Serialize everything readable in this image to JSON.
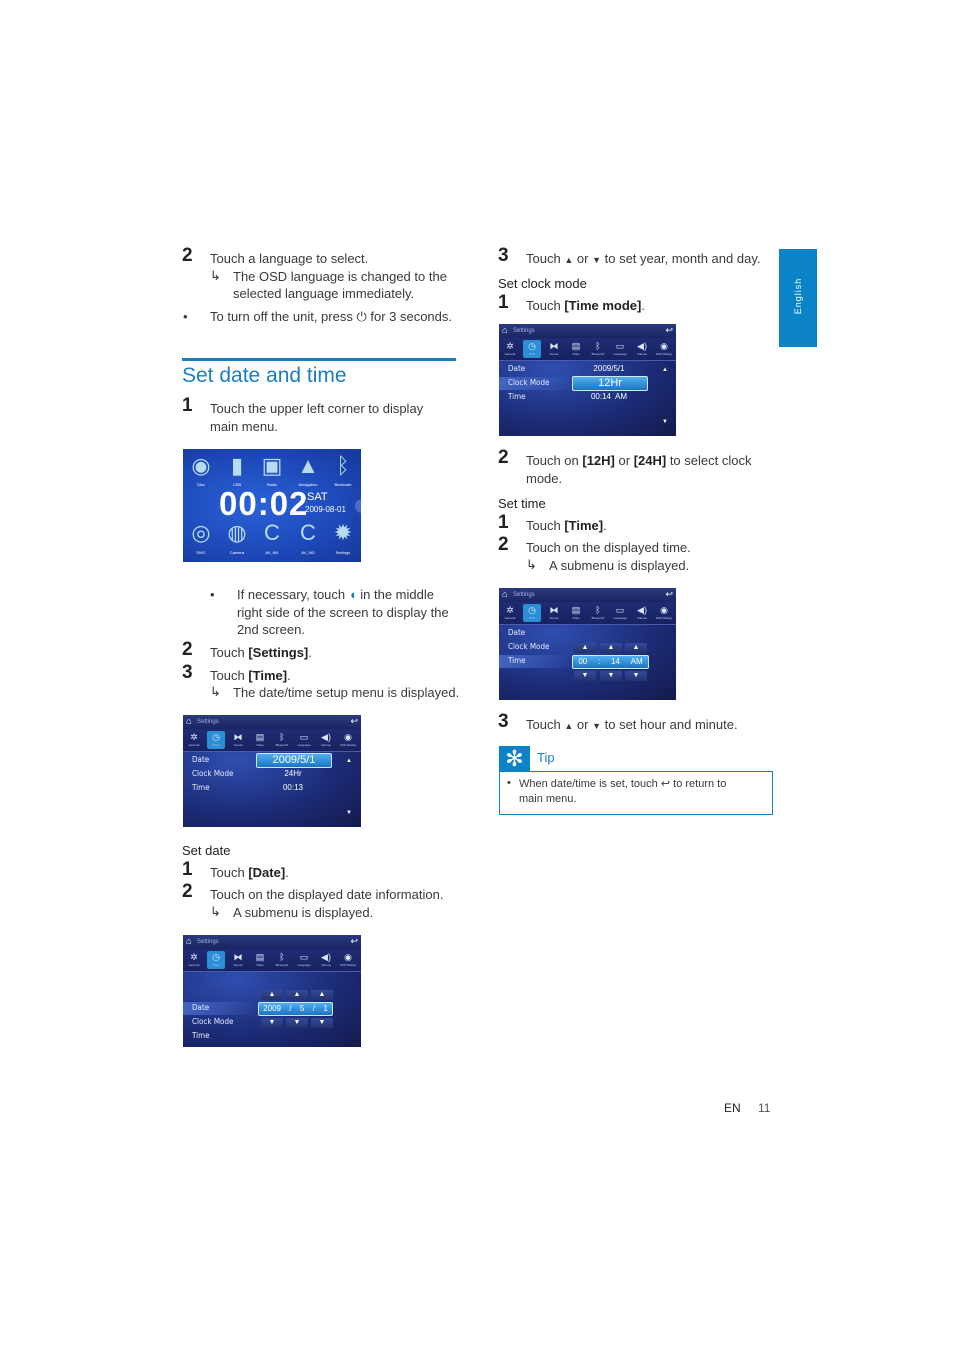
{
  "side_tab": {
    "label": "English"
  },
  "left_column": {
    "step2_lang": {
      "num": "2",
      "text": "Touch a language to select.",
      "result_arrow": "↳",
      "result_line1": "The OSD language is changed to the",
      "result_line2": "selected language immediately."
    },
    "bullet_power": {
      "bullet": "•",
      "text": "To turn off the unit, press ⏻ for 3 seconds."
    },
    "section_title": "Set date and time",
    "step1": {
      "num": "1",
      "line1": "Touch the upper left corner to display",
      "line2": "main menu."
    },
    "main_menu_screen": {
      "top_icons": [
        {
          "icon": "disc-icon",
          "glyph": "◉",
          "label": "Disc"
        },
        {
          "icon": "usb-icon",
          "glyph": "▮",
          "label": "USB"
        },
        {
          "icon": "radio-icon",
          "glyph": "▣",
          "label": "Radio"
        },
        {
          "icon": "navigation-icon",
          "glyph": "▲",
          "label": "Navigation"
        },
        {
          "icon": "bluetooth-icon",
          "glyph": "ᛒ",
          "label": "Bluetooth"
        }
      ],
      "clock": "00:02",
      "day": "SAT",
      "date": "2009-08-01",
      "bottom_icons": [
        {
          "icon": "steering-wheel-icon",
          "glyph": "◎",
          "label": "SWC"
        },
        {
          "icon": "camera-icon",
          "glyph": "◍",
          "label": "Camera"
        },
        {
          "icon": "av-in-icon",
          "glyph": "C",
          "label": "AV_IN1"
        },
        {
          "icon": "av-in-icon",
          "glyph": "C",
          "label": "AV_IN2"
        },
        {
          "icon": "settings-gear-icon",
          "glyph": "✹",
          "label": "Settings"
        }
      ]
    },
    "bullet_second_screen": {
      "bullet": "•",
      "line1a": "If necessary, touch",
      "icon_glyph": "◖",
      "line1b": "in the middle",
      "line2": "right side of the screen to display the",
      "line3": "2nd screen."
    },
    "step2_settings": {
      "num": "2",
      "text_pre": "Touch ",
      "bold": "[Settings]",
      "text_post": "."
    },
    "step3_time": {
      "num": "3",
      "text_pre": "Touch ",
      "bold": "[Time]",
      "text_post": ".",
      "result_arrow": "↳",
      "result": "The date/time setup menu is displayed."
    },
    "set_date_heading": "Set date",
    "set_date_step1": {
      "num": "1",
      "text_pre": "Touch ",
      "bold": "[Date]",
      "text_post": "."
    },
    "set_date_step2": {
      "num": "2",
      "text": "Touch on the displayed date information.",
      "result_arrow": "↳",
      "result": "A submenu is displayed."
    }
  },
  "settings_screen_common": {
    "title": "Settings",
    "home_glyph": "⌂",
    "back_glyph": "↩",
    "tabs": [
      {
        "icon": "gear-icon",
        "glyph": "✲",
        "label": "General"
      },
      {
        "icon": "clock-icon",
        "glyph": "◷",
        "label": "Time"
      },
      {
        "icon": "sound-icon",
        "glyph": "⧓",
        "label": "Sound"
      },
      {
        "icon": "video-icon",
        "glyph": "▤",
        "label": "Video"
      },
      {
        "icon": "bluetooth-icon",
        "glyph": "ᛒ",
        "label": "Bluetooth"
      },
      {
        "icon": "language-icon",
        "glyph": "▭",
        "label": "Language"
      },
      {
        "icon": "volume-icon",
        "glyph": "◀)",
        "label": "Volume"
      },
      {
        "icon": "disc-rating-icon",
        "glyph": "◉",
        "label": "DVD Rating"
      }
    ],
    "up_glyph": "▲",
    "down_glyph": "▼"
  },
  "screen_datetime_menu": {
    "date_label": "Date",
    "date_value": "2009/5/1",
    "clock_label": "Clock Mode",
    "clock_value": "24Hr",
    "time_label": "Time",
    "time_value": "00:13"
  },
  "screen_date_submenu": {
    "date_label": "Date",
    "clock_label": "Clock Mode",
    "time_label": "Time",
    "year": "2009",
    "sep": "/",
    "month": "5",
    "day": "1"
  },
  "right_column": {
    "step3_date": {
      "num": "3",
      "text_pre": "Touch",
      "up": "▲",
      "or": "or",
      "down": "▼",
      "text_post": "to set year, month and day."
    },
    "set_clock_heading": "Set clock mode",
    "clock_step1": {
      "num": "1",
      "text_pre": "Touch ",
      "bold": "[Time mode]",
      "text_post": "."
    },
    "clock_step2": {
      "num": "2",
      "text_pre": "Touch on ",
      "bold1": "[12H]",
      "mid": " or ",
      "bold2": "[24H]",
      "text_post": " to select clock",
      "line2": "mode."
    },
    "set_time_heading": "Set time",
    "time_step1": {
      "num": "1",
      "text_pre": "Touch ",
      "bold": "[Time]",
      "text_post": "."
    },
    "time_step2": {
      "num": "2",
      "text": "Touch on the displayed time.",
      "result_arrow": "↳",
      "result": "A submenu is displayed."
    },
    "time_step3": {
      "num": "3",
      "text_pre": "Touch",
      "up": "▲",
      "or": "or",
      "down": "▼",
      "text_post": "to set hour and minute."
    },
    "tip": {
      "icon_glyph": "✻",
      "title": "Tip",
      "bullet": "•",
      "line1a": "When date/time is set, touch",
      "back_glyph": "↩",
      "line1b": "to return to",
      "line2": "main menu."
    }
  },
  "screen_clock_mode": {
    "date_label": "Date",
    "date_value": "2009/5/1",
    "clock_label": "Clock Mode",
    "clock_value": "12Hr",
    "time_label": "Time",
    "time_value": "00:14  AM"
  },
  "screen_time_submenu": {
    "date_label": "Date",
    "clock_label": "Clock Mode",
    "time_label": "Time",
    "hour": "00",
    "sep": ":",
    "minute": "14",
    "ampm": "AM"
  },
  "footer": {
    "lang": "EN",
    "page": "11"
  }
}
